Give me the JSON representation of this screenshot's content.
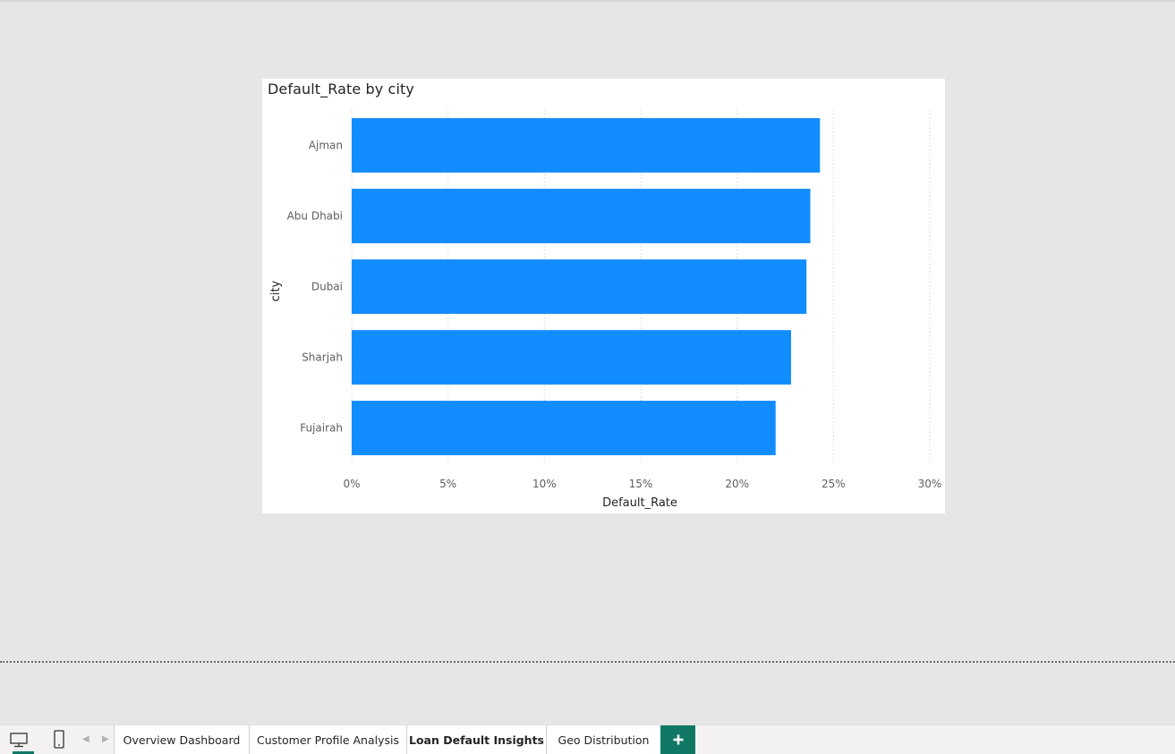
{
  "visual": {
    "title": "Default_Rate by city"
  },
  "chart_data": {
    "type": "bar",
    "orientation": "horizontal",
    "title": "Default_Rate by city",
    "xlabel": "Default_Rate",
    "ylabel": "city",
    "categories": [
      "Ajman",
      "Abu Dhabi",
      "Dubai",
      "Sharjah",
      "Fujairah"
    ],
    "values": [
      24.3,
      23.8,
      23.6,
      22.8,
      22.0
    ],
    "xlim": [
      0,
      30
    ],
    "xticks": [
      "0%",
      "5%",
      "10%",
      "15%",
      "20%",
      "25%",
      "30%"
    ],
    "grid": "vertical dotted",
    "bar_color": "#118dff"
  },
  "tabs": {
    "pages": [
      {
        "label": "Overview Dashboard",
        "active": false
      },
      {
        "label": "Customer Profile Analysis",
        "active": false
      },
      {
        "label": "Loan Default Insights",
        "active": true
      },
      {
        "label": "Geo Distribution",
        "active": false
      }
    ],
    "add_icon": "plus-icon",
    "desktop_icon": "desktop-icon",
    "mobile_icon": "mobile-icon"
  },
  "colors": {
    "accent": "#117865",
    "bar": "#118dff"
  }
}
